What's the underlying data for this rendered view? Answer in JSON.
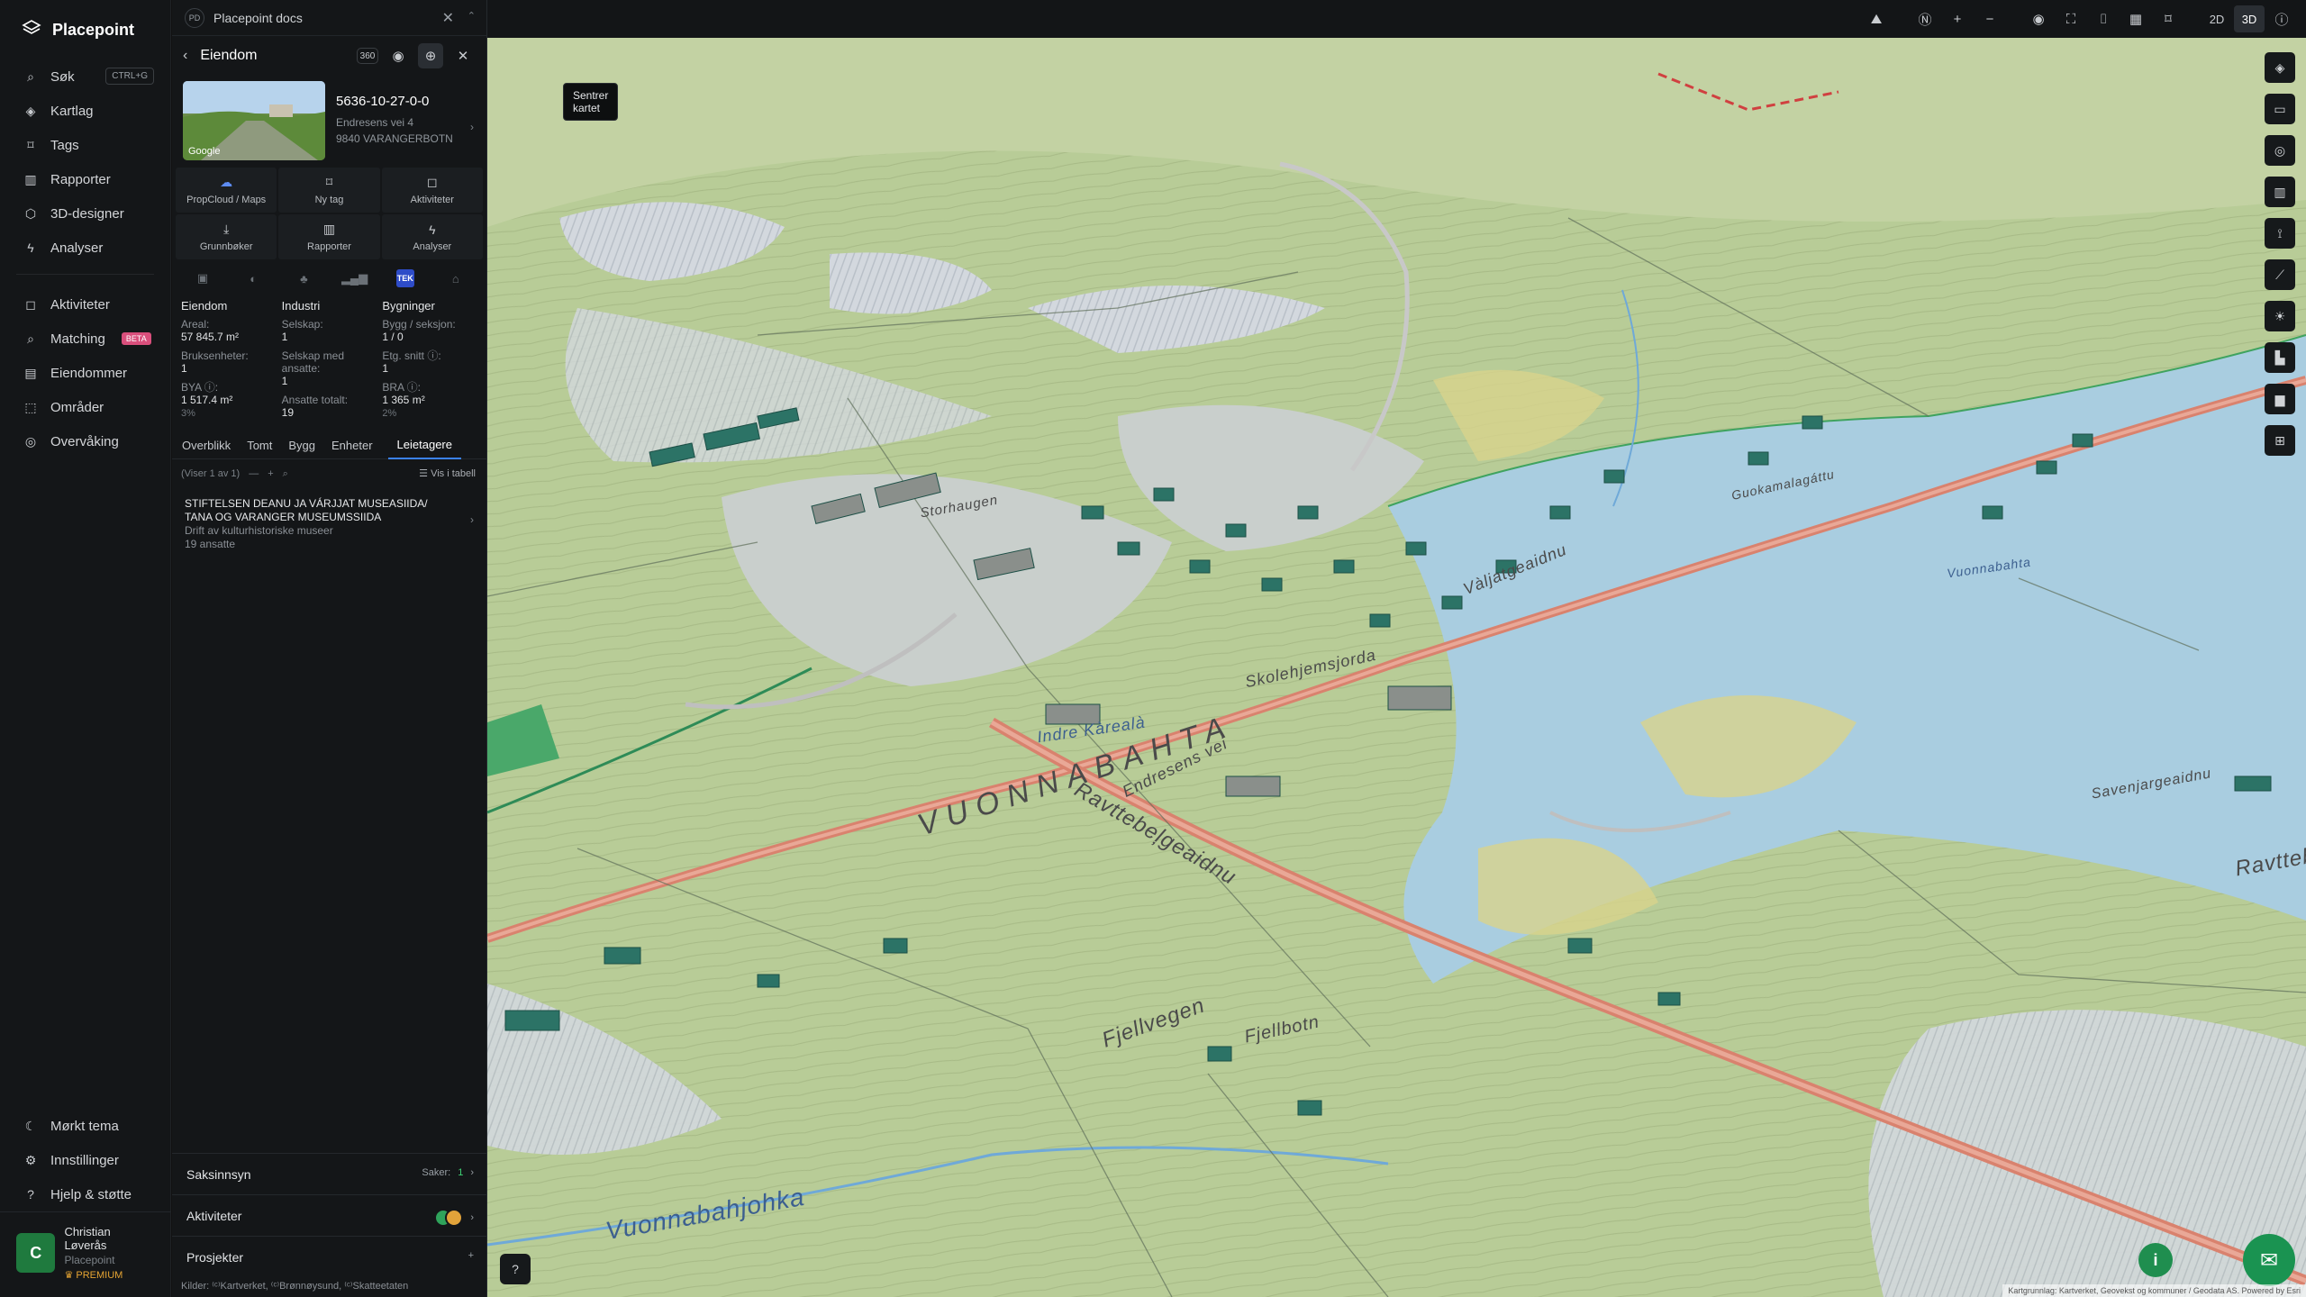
{
  "app": {
    "name": "Placepoint"
  },
  "nav": {
    "search": {
      "label": "Søk",
      "shortcut": "CTRL+G"
    },
    "items_top": [
      {
        "label": "Kartlag",
        "icon": "layers-icon"
      },
      {
        "label": "Tags",
        "icon": "bookmark-icon"
      },
      {
        "label": "Rapporter",
        "icon": "bar-chart-icon"
      },
      {
        "label": "3D-designer",
        "icon": "cube-icon"
      },
      {
        "label": "Analyser",
        "icon": "bolt-icon"
      }
    ],
    "items_mid": [
      {
        "label": "Aktiviteter",
        "icon": "chat-icon"
      },
      {
        "label": "Matching",
        "icon": "search-icon",
        "badge": "BETA"
      },
      {
        "label": "Eiendommer",
        "icon": "building-icon"
      },
      {
        "label": "Områder",
        "icon": "area-icon"
      },
      {
        "label": "Overvåking",
        "icon": "monitor-icon"
      }
    ],
    "items_bottom": [
      {
        "label": "Mørkt tema",
        "icon": "moon-icon"
      },
      {
        "label": "Innstillinger",
        "icon": "gear-icon"
      },
      {
        "label": "Hjelp & støtte",
        "icon": "help-icon"
      }
    ],
    "user": {
      "initial": "C",
      "name": "Christian Løverås",
      "org": "Placepoint",
      "plan": "PREMIUM"
    }
  },
  "doc_tab": {
    "badge": "PD",
    "title": "Placepoint docs"
  },
  "panel": {
    "title": "Eiendom",
    "tooltip": "Sentrer kartet",
    "property": {
      "thumb_label": "Google",
      "id": "5636-10-27-0-0",
      "address_line1": "Endresens vei 4",
      "address_line2": "9840 VARANGERBOTN"
    },
    "actions": [
      {
        "label": "PropCloud / Maps",
        "icon": "cloud-icon"
      },
      {
        "label": "Ny tag",
        "icon": "bookmark-icon"
      },
      {
        "label": "Aktiviteter",
        "icon": "chat-icon"
      },
      {
        "label": "Grunnbøker",
        "icon": "download-icon"
      },
      {
        "label": "Rapporter",
        "icon": "bar-chart-icon"
      },
      {
        "label": "Analyser",
        "icon": "bolt-icon"
      }
    ],
    "categories": [
      "bus-icon",
      "globe-icon",
      "plant-icon",
      "bars-icon",
      "TEK",
      "map-pin-icon"
    ],
    "stats": {
      "eiendom": {
        "title": "Eiendom",
        "areal_label": "Areal:",
        "areal_value": "57 845.7 m²",
        "bruks_label": "Bruksenheter:",
        "bruks_value": "1",
        "bya_label": "BYA ⓘ:",
        "bya_value": "1 517.4 m²",
        "bya_pct": "3%"
      },
      "industri": {
        "title": "Industri",
        "selskap_label": "Selskap:",
        "selskap_value": "1",
        "ansatte_label": "Selskap med ansatte:",
        "ansatte_value": "1",
        "totalt_label": "Ansatte totalt:",
        "totalt_value": "19"
      },
      "bygninger": {
        "title": "Bygninger",
        "bygg_label": "Bygg / seksjon:",
        "bygg_value": "1 / 0",
        "etg_label": "Etg. snitt ⓘ:",
        "etg_value": "1",
        "bra_label": "BRA ⓘ:",
        "bra_value": "1 365 m²",
        "bra_pct": "2%"
      }
    },
    "subtabs": [
      "Overblikk",
      "Tomt",
      "Bygg",
      "Enheter",
      "Leietagere"
    ],
    "list": {
      "showing": "(Viser 1 av 1)",
      "table_button": "Vis i tabell"
    },
    "tenant": {
      "name": "STIFTELSEN DEANU JA VÁRJJAT MUSEASIIDA/ TANA OG VARANGER MUSEUMSSIIDA",
      "activity": "Drift av kulturhistoriske museer",
      "employees": "19 ansatte"
    },
    "sections": [
      {
        "label": "Saksinnsyn",
        "meta_label": "Saker:",
        "meta_value": "1"
      },
      {
        "label": "Aktiviteter"
      },
      {
        "label": "Prosjekter"
      }
    ],
    "sources": "Kilder: ⁽ᶜ⁾Kartverket, ⁽ᶜ⁾Brønnøysund, ⁽ᶜ⁾Skatteetaten"
  },
  "topbar": {
    "mode_2d": "2D",
    "mode_3d": "3D"
  },
  "map": {
    "labels": [
      {
        "text": "Vuonnabahta",
        "kind": "water"
      },
      {
        "text": "Storhaugen",
        "kind": "place"
      },
      {
        "text": "Vuonnabahjohka",
        "kind": "water"
      },
      {
        "text": "Ravttebeļgeaidnu",
        "kind": "road"
      },
      {
        "text": "Fjellvegen",
        "kind": "road"
      },
      {
        "text": "Guokamalagáttu",
        "kind": "road"
      },
      {
        "text": "Skolehjemsjorda",
        "kind": "road"
      },
      {
        "text": "Endresens vei",
        "kind": "road"
      },
      {
        "text": "Savenjargeaidnu",
        "kind": "road"
      },
      {
        "text": "Ravttebel",
        "kind": "road"
      },
      {
        "text": "Fjellbotn",
        "kind": "place"
      },
      {
        "text": "VUONNABAHTA",
        "kind": "place"
      },
      {
        "text": "Vàljatgeaidnu",
        "kind": "road"
      },
      {
        "text": "Indre Kàrealà",
        "kind": "water"
      }
    ],
    "attribution": "Kartgrunnlag: Kartverket, Geovekst og kommuner / Geodata AS. Powered by Esri"
  },
  "colors": {
    "accent": "#3b82f6",
    "brand_green": "#1a9351",
    "beta": "#d94f7c"
  }
}
